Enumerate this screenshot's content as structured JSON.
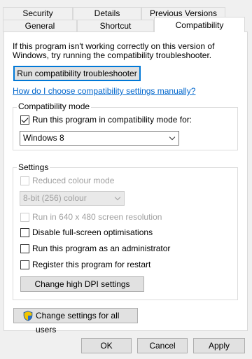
{
  "tabs": {
    "row1": [
      "Security",
      "Details",
      "Previous Versions"
    ],
    "row2": [
      "General",
      "Shortcut",
      "Compatibility"
    ]
  },
  "intro_text": "If this program isn't working correctly on this version of Windows, try running the compatibility troubleshooter.",
  "troubleshooter_button": "Run compatibility troubleshooter",
  "manual_link": "How do I choose compatibility settings manually?",
  "compat_mode": {
    "legend": "Compatibility mode",
    "checkbox_label": "Run this program in compatibility mode for:",
    "checked": true,
    "selected_os": "Windows 8"
  },
  "settings": {
    "legend": "Settings",
    "reduced_colour": "Reduced colour mode",
    "colour_depth": "8-bit (256) colour",
    "run_640": "Run in 640 x 480 screen resolution",
    "disable_fullscreen": "Disable full-screen optimisations",
    "run_admin": "Run this program as an administrator",
    "register_restart": "Register this program for restart",
    "high_dpi_button": "Change high DPI settings"
  },
  "all_users_button": "Change settings for all users",
  "footer": {
    "ok": "OK",
    "cancel": "Cancel",
    "apply": "Apply"
  },
  "colors": {
    "link": "#0066cc",
    "accent_border": "#0078d7",
    "disabled_text": "#a0a0a0"
  },
  "icons": {
    "shield": "uac-shield-icon"
  }
}
